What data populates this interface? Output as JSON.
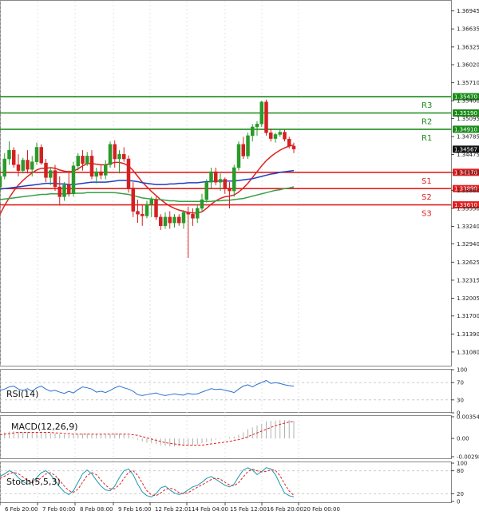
{
  "chart_data": {
    "type": "candlestick",
    "price_axis": {
      "ylim": [
        1.309,
        1.3705
      ],
      "ticks": [
        "1.36945",
        "1.36635",
        "1.36325",
        "1.36020",
        "1.35710",
        "1.35400",
        "1.35095",
        "1.34785",
        "1.34475",
        "1.34165",
        "1.33860",
        "1.33550",
        "1.33240",
        "1.32940",
        "1.32625",
        "1.32315",
        "1.32005",
        "1.31700",
        "1.31390",
        "1.31080"
      ]
    },
    "time_labels": [
      "6 Feb 20:00",
      "7 Feb 00:00",
      "8 Feb 08:00",
      "9 Feb 16:00",
      "12 Feb 22:01",
      "14 Feb 04:00",
      "15 Feb 12:00",
      "16 Feb 20:00",
      "20 Feb 00:00"
    ],
    "current_price": {
      "value": 1.34567,
      "label": "1.34567"
    },
    "levels": [
      {
        "name": "R3",
        "value": 1.3547,
        "label": "1.35470",
        "color": "#1a8a1a"
      },
      {
        "name": "R2",
        "value": 1.3519,
        "label": "1.35190",
        "color": "#1a8a1a"
      },
      {
        "name": "R1",
        "value": 1.3491,
        "label": "1.34910",
        "color": "#1a8a1a"
      },
      {
        "name": "S1",
        "value": 1.3417,
        "label": "1.34170",
        "color": "#e02020"
      },
      {
        "name": "S2",
        "value": 1.3389,
        "label": "1.33890",
        "color": "#e02020"
      },
      {
        "name": "S3",
        "value": 1.3361,
        "label": "1.33610",
        "color": "#e02020"
      }
    ],
    "candles": [
      {
        "o": 1.3392,
        "h": 1.3425,
        "l": 1.3385,
        "c": 1.341
      },
      {
        "o": 1.341,
        "h": 1.345,
        "l": 1.3405,
        "c": 1.344
      },
      {
        "o": 1.344,
        "h": 1.347,
        "l": 1.343,
        "c": 1.3455
      },
      {
        "o": 1.3455,
        "h": 1.346,
        "l": 1.3425,
        "c": 1.343
      },
      {
        "o": 1.343,
        "h": 1.3448,
        "l": 1.341,
        "c": 1.342
      },
      {
        "o": 1.342,
        "h": 1.3442,
        "l": 1.3415,
        "c": 1.3438
      },
      {
        "o": 1.3438,
        "h": 1.3455,
        "l": 1.3415,
        "c": 1.3422
      },
      {
        "o": 1.3422,
        "h": 1.3445,
        "l": 1.341,
        "c": 1.3435
      },
      {
        "o": 1.3435,
        "h": 1.3468,
        "l": 1.343,
        "c": 1.346
      },
      {
        "o": 1.346,
        "h": 1.3465,
        "l": 1.343,
        "c": 1.3433
      },
      {
        "o": 1.3433,
        "h": 1.344,
        "l": 1.34,
        "c": 1.3408
      },
      {
        "o": 1.3408,
        "h": 1.3425,
        "l": 1.3395,
        "c": 1.342
      },
      {
        "o": 1.342,
        "h": 1.343,
        "l": 1.3385,
        "c": 1.3392
      },
      {
        "o": 1.3392,
        "h": 1.341,
        "l": 1.336,
        "c": 1.3375
      },
      {
        "o": 1.3375,
        "h": 1.34,
        "l": 1.3368,
        "c": 1.3395
      },
      {
        "o": 1.3395,
        "h": 1.342,
        "l": 1.3375,
        "c": 1.338
      },
      {
        "o": 1.338,
        "h": 1.3435,
        "l": 1.3375,
        "c": 1.3428
      },
      {
        "o": 1.3428,
        "h": 1.345,
        "l": 1.342,
        "c": 1.3445
      },
      {
        "o": 1.3445,
        "h": 1.3455,
        "l": 1.342,
        "c": 1.3432
      },
      {
        "o": 1.3432,
        "h": 1.3452,
        "l": 1.3428,
        "c": 1.3445
      },
      {
        "o": 1.3445,
        "h": 1.3455,
        "l": 1.3405,
        "c": 1.341
      },
      {
        "o": 1.341,
        "h": 1.3425,
        "l": 1.3398,
        "c": 1.3418
      },
      {
        "o": 1.3418,
        "h": 1.343,
        "l": 1.3405,
        "c": 1.3412
      },
      {
        "o": 1.3412,
        "h": 1.3438,
        "l": 1.3405,
        "c": 1.343
      },
      {
        "o": 1.343,
        "h": 1.347,
        "l": 1.3425,
        "c": 1.3465
      },
      {
        "o": 1.3465,
        "h": 1.3472,
        "l": 1.3425,
        "c": 1.344
      },
      {
        "o": 1.344,
        "h": 1.3455,
        "l": 1.3415,
        "c": 1.3448
      },
      {
        "o": 1.3448,
        "h": 1.346,
        "l": 1.3435,
        "c": 1.344
      },
      {
        "o": 1.344,
        "h": 1.3446,
        "l": 1.3382,
        "c": 1.339
      },
      {
        "o": 1.339,
        "h": 1.34,
        "l": 1.334,
        "c": 1.335
      },
      {
        "o": 1.335,
        "h": 1.337,
        "l": 1.333,
        "c": 1.3345
      },
      {
        "o": 1.3345,
        "h": 1.3362,
        "l": 1.3325,
        "c": 1.3342
      },
      {
        "o": 1.3342,
        "h": 1.3368,
        "l": 1.3338,
        "c": 1.3362
      },
      {
        "o": 1.3362,
        "h": 1.3375,
        "l": 1.334,
        "c": 1.337
      },
      {
        "o": 1.337,
        "h": 1.3375,
        "l": 1.3335,
        "c": 1.334
      },
      {
        "o": 1.334,
        "h": 1.3345,
        "l": 1.3318,
        "c": 1.3325
      },
      {
        "o": 1.3325,
        "h": 1.3348,
        "l": 1.332,
        "c": 1.334
      },
      {
        "o": 1.334,
        "h": 1.335,
        "l": 1.332,
        "c": 1.333
      },
      {
        "o": 1.333,
        "h": 1.3345,
        "l": 1.3322,
        "c": 1.334
      },
      {
        "o": 1.334,
        "h": 1.3345,
        "l": 1.3325,
        "c": 1.333
      },
      {
        "o": 1.333,
        "h": 1.3352,
        "l": 1.332,
        "c": 1.3348
      },
      {
        "o": 1.3348,
        "h": 1.3358,
        "l": 1.327,
        "c": 1.3345
      },
      {
        "o": 1.3345,
        "h": 1.3355,
        "l": 1.3325,
        "c": 1.3338
      },
      {
        "o": 1.3338,
        "h": 1.3362,
        "l": 1.333,
        "c": 1.3355
      },
      {
        "o": 1.3355,
        "h": 1.338,
        "l": 1.3348,
        "c": 1.337
      },
      {
        "o": 1.337,
        "h": 1.3405,
        "l": 1.3365,
        "c": 1.34
      },
      {
        "o": 1.34,
        "h": 1.3425,
        "l": 1.339,
        "c": 1.3418
      },
      {
        "o": 1.3418,
        "h": 1.3425,
        "l": 1.3395,
        "c": 1.34
      },
      {
        "o": 1.34,
        "h": 1.3415,
        "l": 1.3385,
        "c": 1.3405
      },
      {
        "o": 1.3405,
        "h": 1.3408,
        "l": 1.338,
        "c": 1.339
      },
      {
        "o": 1.339,
        "h": 1.34,
        "l": 1.3355,
        "c": 1.3385
      },
      {
        "o": 1.3385,
        "h": 1.343,
        "l": 1.3375,
        "c": 1.3425
      },
      {
        "o": 1.3425,
        "h": 1.347,
        "l": 1.342,
        "c": 1.3465
      },
      {
        "o": 1.3465,
        "h": 1.3478,
        "l": 1.344,
        "c": 1.3445
      },
      {
        "o": 1.3445,
        "h": 1.3485,
        "l": 1.344,
        "c": 1.348
      },
      {
        "o": 1.348,
        "h": 1.35,
        "l": 1.347,
        "c": 1.3495
      },
      {
        "o": 1.3495,
        "h": 1.3505,
        "l": 1.348,
        "c": 1.35
      },
      {
        "o": 1.35,
        "h": 1.354,
        "l": 1.3495,
        "c": 1.3538
      },
      {
        "o": 1.3538,
        "h": 1.3542,
        "l": 1.348,
        "c": 1.3485
      },
      {
        "o": 1.3485,
        "h": 1.3492,
        "l": 1.347,
        "c": 1.3475
      },
      {
        "o": 1.3475,
        "h": 1.3485,
        "l": 1.3468,
        "c": 1.3482
      },
      {
        "o": 1.3482,
        "h": 1.3492,
        "l": 1.3478,
        "c": 1.3486
      },
      {
        "o": 1.3486,
        "h": 1.349,
        "l": 1.347,
        "c": 1.3474
      },
      {
        "o": 1.3474,
        "h": 1.3478,
        "l": 1.3458,
        "c": 1.3462
      },
      {
        "o": 1.3462,
        "h": 1.3468,
        "l": 1.345,
        "c": 1.3457
      }
    ],
    "ma_series": [
      {
        "color": "#e02020",
        "values": [
          1.3345,
          1.336,
          1.3373,
          1.3385,
          1.3395,
          1.3403,
          1.341,
          1.3416,
          1.3421,
          1.3424,
          1.3424,
          1.3425,
          1.3424,
          1.3421,
          1.3419,
          1.3418,
          1.3419,
          1.3423,
          1.3428,
          1.3432,
          1.3432,
          1.3431,
          1.343,
          1.343,
          1.3432,
          1.3434,
          1.3434,
          1.3432,
          1.3428,
          1.342,
          1.341,
          1.34,
          1.3392,
          1.3384,
          1.3377,
          1.337,
          1.3364,
          1.3359,
          1.3355,
          1.3352,
          1.335,
          1.3348,
          1.3347,
          1.3347,
          1.3349,
          1.3355,
          1.3362,
          1.3368,
          1.3372,
          1.3375,
          1.3376,
          1.3378,
          1.3383,
          1.339,
          1.3398,
          1.3408,
          1.3418,
          1.3428,
          1.3437,
          1.3444,
          1.345,
          1.3455,
          1.3459,
          1.3462,
          1.3464
        ]
      },
      {
        "color": "#2040c0",
        "values": [
          1.3388,
          1.3389,
          1.339,
          1.3391,
          1.3392,
          1.3393,
          1.3394,
          1.3395,
          1.3396,
          1.3397,
          1.3398,
          1.3398,
          1.3398,
          1.3397,
          1.3397,
          1.3396,
          1.3396,
          1.3397,
          1.3398,
          1.3399,
          1.34,
          1.34,
          1.34,
          1.34,
          1.3401,
          1.3402,
          1.3403,
          1.3403,
          1.3403,
          1.3402,
          1.3401,
          1.3399,
          1.3398,
          1.3397,
          1.3396,
          1.3396,
          1.3396,
          1.3397,
          1.3397,
          1.3398,
          1.3398,
          1.3399,
          1.3399,
          1.3399,
          1.34,
          1.3401,
          1.3401,
          1.3402,
          1.3402,
          1.3402,
          1.3402,
          1.3402,
          1.3403,
          1.3404,
          1.3405,
          1.3406,
          1.3408,
          1.341,
          1.3412,
          1.3414,
          1.3415,
          1.3417,
          1.3418,
          1.3419,
          1.342
        ]
      },
      {
        "color": "#38a048",
        "values": [
          1.337,
          1.3371,
          1.3372,
          1.3373,
          1.3374,
          1.3375,
          1.3376,
          1.3377,
          1.3378,
          1.3379,
          1.3379,
          1.338,
          1.338,
          1.338,
          1.338,
          1.338,
          1.3381,
          1.3381,
          1.3381,
          1.3382,
          1.3382,
          1.3382,
          1.3382,
          1.3382,
          1.3382,
          1.3382,
          1.3381,
          1.338,
          1.3379,
          1.3377,
          1.3375,
          1.3373,
          1.3372,
          1.3371,
          1.337,
          1.337,
          1.3369,
          1.3368,
          1.3368,
          1.3367,
          1.3367,
          1.3367,
          1.3367,
          1.3367,
          1.3367,
          1.3367,
          1.3367,
          1.3368,
          1.3368,
          1.3369,
          1.3369,
          1.337,
          1.3371,
          1.3372,
          1.3374,
          1.3376,
          1.3378,
          1.338,
          1.3382,
          1.3384,
          1.3386,
          1.3387,
          1.3389,
          1.339,
          1.3392
        ]
      }
    ],
    "rsi": {
      "label": "RSI(14)",
      "ticks": [
        "100",
        "70",
        "30",
        "0"
      ],
      "values": [
        52,
        55,
        60,
        62,
        55,
        52,
        56,
        50,
        58,
        62,
        55,
        50,
        52,
        48,
        45,
        50,
        46,
        54,
        60,
        58,
        55,
        48,
        50,
        47,
        52,
        58,
        62,
        58,
        55,
        50,
        42,
        40,
        42,
        44,
        46,
        42,
        40,
        42,
        44,
        42,
        41,
        45,
        43,
        44,
        48,
        52,
        56,
        54,
        55,
        52,
        50,
        47,
        55,
        62,
        65,
        60,
        66,
        70,
        75,
        68,
        70,
        68,
        65,
        63,
        62
      ]
    },
    "macd": {
      "label": "MACD(12,26,9)",
      "ticks": [
        "0.003542",
        "0.00",
        "-0.002987"
      ],
      "hist": [
        0.0008,
        0.001,
        0.0011,
        0.0012,
        0.0011,
        0.001,
        0.001,
        0.001,
        0.0011,
        0.0011,
        0.001,
        0.0009,
        0.0008,
        0.0007,
        0.0006,
        0.0006,
        0.0006,
        0.0007,
        0.0008,
        0.0008,
        0.0008,
        0.0007,
        0.0007,
        0.0006,
        0.0007,
        0.0008,
        0.0008,
        0.0007,
        0.0005,
        0.0002,
        -0.0002,
        -0.0005,
        -0.0007,
        -0.0008,
        -0.0009,
        -0.0011,
        -0.0012,
        -0.0013,
        -0.0013,
        -0.0013,
        -0.0012,
        -0.0012,
        -0.0011,
        -0.001,
        -0.0008,
        -0.0006,
        -0.0004,
        -0.0002,
        -0.0001,
        0.0,
        0.0002,
        0.0003,
        0.0006,
        0.001,
        0.0015,
        0.0018,
        0.0021,
        0.0024,
        0.0028,
        0.0029,
        0.0029,
        0.003,
        0.003,
        0.003,
        0.0029
      ],
      "signal": [
        0.0006,
        0.0007,
        0.0008,
        0.0009,
        0.001,
        0.001,
        0.001,
        0.001,
        0.001,
        0.001,
        0.001,
        0.001,
        0.0009,
        0.0009,
        0.0008,
        0.0008,
        0.0007,
        0.0007,
        0.0007,
        0.0007,
        0.0007,
        0.0007,
        0.0007,
        0.0007,
        0.0007,
        0.0007,
        0.0007,
        0.0007,
        0.0007,
        0.0006,
        0.0005,
        0.0003,
        0.0001,
        -0.0001,
        -0.0003,
        -0.0005,
        -0.0007,
        -0.0008,
        -0.0009,
        -0.001,
        -0.0011,
        -0.0011,
        -0.0011,
        -0.0011,
        -0.0011,
        -0.001,
        -0.0009,
        -0.0008,
        -0.0007,
        -0.0006,
        -0.0005,
        -0.0003,
        -0.0002,
        0.0,
        0.0003,
        0.0006,
        0.0009,
        0.0012,
        0.0015,
        0.0018,
        0.0021,
        0.0023,
        0.0025,
        0.0027,
        0.0028
      ]
    },
    "stoch": {
      "label": "Stoch(5,5,3)",
      "ticks": [
        "100",
        "80",
        "20",
        "0"
      ],
      "k": [
        65,
        72,
        80,
        75,
        62,
        52,
        45,
        50,
        62,
        75,
        80,
        70,
        55,
        38,
        25,
        18,
        28,
        50,
        72,
        82,
        72,
        55,
        40,
        30,
        28,
        40,
        62,
        80,
        85,
        70,
        45,
        25,
        15,
        12,
        20,
        35,
        40,
        30,
        22,
        18,
        22,
        30,
        38,
        42,
        50,
        60,
        65,
        58,
        50,
        42,
        38,
        45,
        65,
        82,
        88,
        82,
        70,
        78,
        88,
        85,
        70,
        45,
        22,
        15,
        12
      ],
      "d": [
        60,
        66,
        72,
        76,
        72,
        64,
        54,
        49,
        52,
        62,
        72,
        75,
        68,
        55,
        40,
        28,
        24,
        32,
        50,
        68,
        75,
        70,
        56,
        42,
        33,
        33,
        43,
        60,
        76,
        80,
        68,
        48,
        28,
        17,
        15,
        22,
        31,
        35,
        31,
        23,
        20,
        23,
        30,
        37,
        43,
        50,
        57,
        61,
        58,
        50,
        43,
        41,
        49,
        64,
        78,
        84,
        80,
        77,
        78,
        83,
        81,
        67,
        46,
        27,
        16
      ]
    }
  }
}
